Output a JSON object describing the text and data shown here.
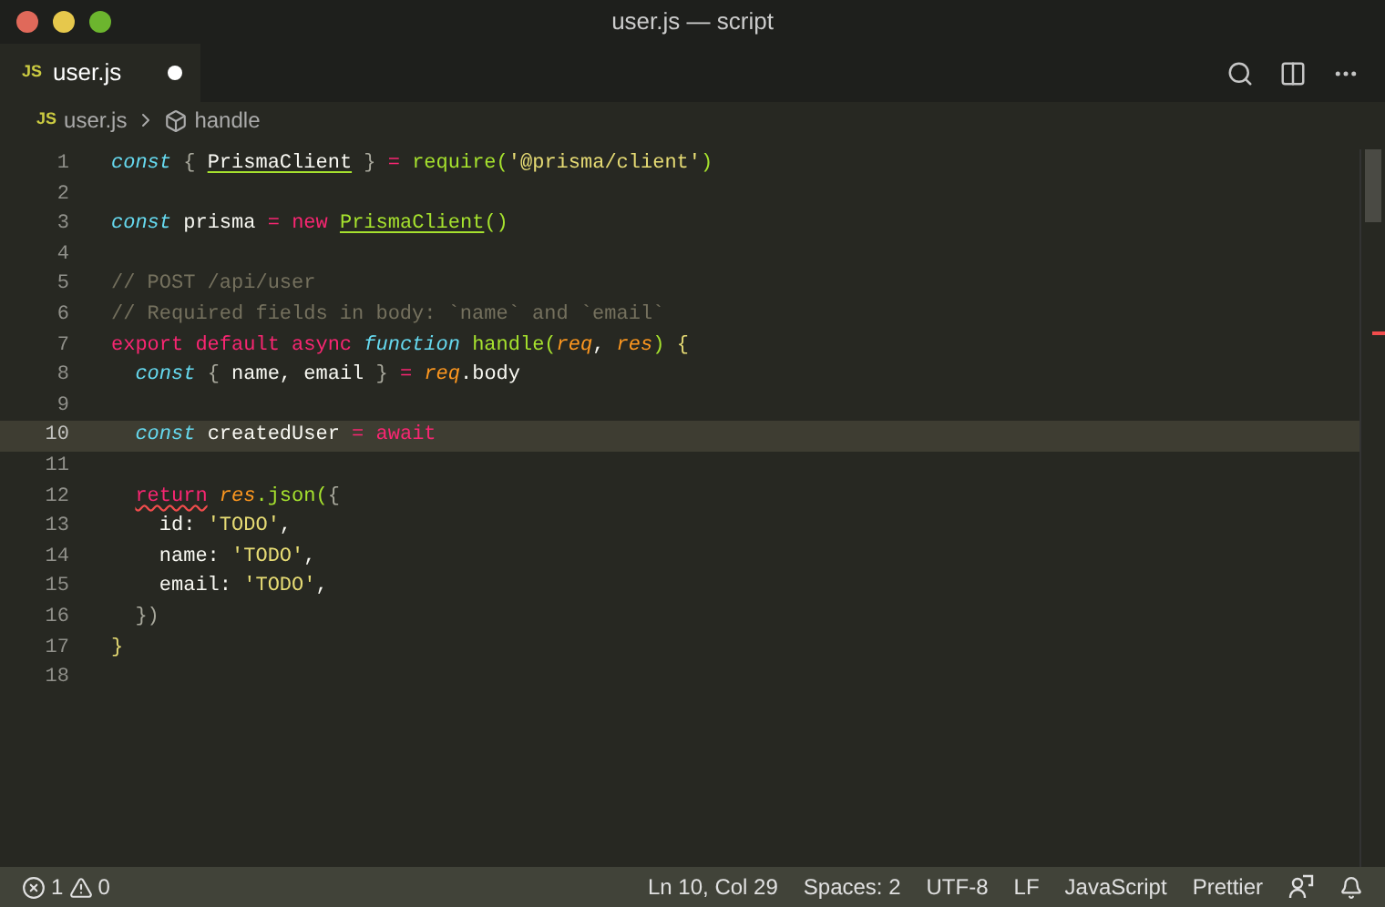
{
  "window": {
    "title": "user.js — script"
  },
  "tabs": [
    {
      "badge": "JS",
      "label": "user.js",
      "selected": true,
      "dirty": true
    }
  ],
  "breadcrumb": {
    "badge": "JS",
    "file": "user.js",
    "symbol": "handle"
  },
  "editor": {
    "lines": [
      {
        "number": "1",
        "current": false,
        "tokens": [
          {
            "text": "const",
            "kind": "keyword",
            "highlighted": false,
            "error": false
          },
          {
            "text": " { ",
            "kind": "punct",
            "highlighted": false,
            "error": false
          },
          {
            "text": "PrismaClient",
            "kind": "plain",
            "highlighted": true,
            "error": false
          },
          {
            "text": " } ",
            "kind": "punct",
            "highlighted": false,
            "error": false
          },
          {
            "text": "=",
            "kind": "storage",
            "highlighted": false,
            "error": false
          },
          {
            "text": " require(",
            "kind": "func",
            "highlighted": false,
            "error": false
          },
          {
            "text": "'@prisma/client'",
            "kind": "string",
            "highlighted": false,
            "error": false
          },
          {
            "text": ")",
            "kind": "func",
            "highlighted": false,
            "error": false
          }
        ]
      },
      {
        "number": "2",
        "current": false
      },
      {
        "number": "3",
        "current": false,
        "tokens": [
          {
            "text": "const",
            "kind": "keyword",
            "highlighted": false,
            "error": false
          },
          {
            "text": " prisma ",
            "kind": "plain",
            "highlighted": false,
            "error": false
          },
          {
            "text": "=",
            "kind": "storage",
            "highlighted": false,
            "error": false
          },
          {
            "text": " new ",
            "kind": "storage",
            "highlighted": false,
            "error": false
          },
          {
            "text": "PrismaClient",
            "kind": "func",
            "highlighted": true,
            "error": false
          },
          {
            "text": "()",
            "kind": "func",
            "highlighted": false,
            "error": false
          }
        ]
      },
      {
        "number": "4",
        "current": false
      },
      {
        "number": "5",
        "current": false,
        "tokens": [
          {
            "text": "// POST /api/user",
            "kind": "comment",
            "highlighted": false,
            "error": false
          }
        ]
      },
      {
        "number": "6",
        "current": false,
        "tokens": [
          {
            "text": "// Required fields in body: `name` and `email`",
            "kind": "comment",
            "highlighted": false,
            "error": false
          }
        ]
      },
      {
        "number": "7",
        "current": false,
        "tokens": [
          {
            "text": "export default async",
            "kind": "storage",
            "highlighted": false,
            "error": false
          },
          {
            "text": " function",
            "kind": "keyword",
            "highlighted": false,
            "error": false
          },
          {
            "text": " handle(",
            "kind": "func",
            "highlighted": false,
            "error": false
          },
          {
            "text": "req",
            "kind": "param",
            "highlighted": false,
            "error": false
          },
          {
            "text": ", ",
            "kind": "plain",
            "highlighted": false,
            "error": false
          },
          {
            "text": "res",
            "kind": "param",
            "highlighted": false,
            "error": false
          },
          {
            "text": ") ",
            "kind": "func",
            "highlighted": false,
            "error": false
          },
          {
            "text": "{",
            "kind": "string",
            "highlighted": false,
            "error": false
          }
        ]
      },
      {
        "number": "8",
        "current": false,
        "tokens": [
          {
            "text": "  const",
            "kind": "keyword",
            "highlighted": false,
            "error": false
          },
          {
            "text": " { ",
            "kind": "punct",
            "highlighted": false,
            "error": false
          },
          {
            "text": "name, email",
            "kind": "plain",
            "highlighted": false,
            "error": false
          },
          {
            "text": " } ",
            "kind": "punct",
            "highlighted": false,
            "error": false
          },
          {
            "text": "=",
            "kind": "storage",
            "highlighted": false,
            "error": false
          },
          {
            "text": " req",
            "kind": "param",
            "highlighted": false,
            "error": false
          },
          {
            "text": ".body",
            "kind": "plain",
            "highlighted": false,
            "error": false
          }
        ]
      },
      {
        "number": "9",
        "current": false
      },
      {
        "number": "10",
        "current": true,
        "tokens": [
          {
            "text": "  const",
            "kind": "keyword",
            "highlighted": false,
            "error": false
          },
          {
            "text": " createdUser ",
            "kind": "plain",
            "highlighted": false,
            "error": false
          },
          {
            "text": "=",
            "kind": "storage",
            "highlighted": false,
            "error": false
          },
          {
            "text": " await",
            "kind": "storage",
            "highlighted": false,
            "error": false
          }
        ]
      },
      {
        "number": "11",
        "current": false
      },
      {
        "number": "12",
        "current": false,
        "tokens": [
          {
            "text": "  return",
            "kind": "storage",
            "highlighted": false,
            "error": true
          },
          {
            "text": " res",
            "kind": "param",
            "highlighted": false,
            "error": false
          },
          {
            "text": ".json(",
            "kind": "func",
            "highlighted": false,
            "error": false
          },
          {
            "text": "{",
            "kind": "punct",
            "highlighted": false,
            "error": false
          }
        ]
      },
      {
        "number": "13",
        "current": false,
        "tokens": [
          {
            "text": "    id: ",
            "kind": "plain",
            "highlighted": false,
            "error": false
          },
          {
            "text": "'TODO'",
            "kind": "string",
            "highlighted": false,
            "error": false
          },
          {
            "text": ",",
            "kind": "plain",
            "highlighted": false,
            "error": false
          }
        ]
      },
      {
        "number": "14",
        "current": false,
        "tokens": [
          {
            "text": "    name: ",
            "kind": "plain",
            "highlighted": false,
            "error": false
          },
          {
            "text": "'TODO'",
            "kind": "string",
            "highlighted": false,
            "error": false
          },
          {
            "text": ",",
            "kind": "plain",
            "highlighted": false,
            "error": false
          }
        ]
      },
      {
        "number": "15",
        "current": false,
        "tokens": [
          {
            "text": "    email: ",
            "kind": "plain",
            "highlighted": false,
            "error": false
          },
          {
            "text": "'TODO'",
            "kind": "string",
            "highlighted": false,
            "error": false
          },
          {
            "text": ",",
            "kind": "plain",
            "highlighted": false,
            "error": false
          }
        ]
      },
      {
        "number": "16",
        "current": false,
        "tokens": [
          {
            "text": "  })",
            "kind": "punct",
            "highlighted": false,
            "error": false
          }
        ]
      },
      {
        "number": "17",
        "current": false,
        "tokens": [
          {
            "text": "}",
            "kind": "string",
            "highlighted": false,
            "error": false
          }
        ]
      },
      {
        "number": "18",
        "current": false
      }
    ]
  },
  "status_bar": {
    "errors": "1",
    "warnings": "0",
    "items": [
      "Ln 10, Col 29",
      "Spaces: 2",
      "UTF-8",
      "LF",
      "JavaScript",
      "Prettier"
    ]
  }
}
